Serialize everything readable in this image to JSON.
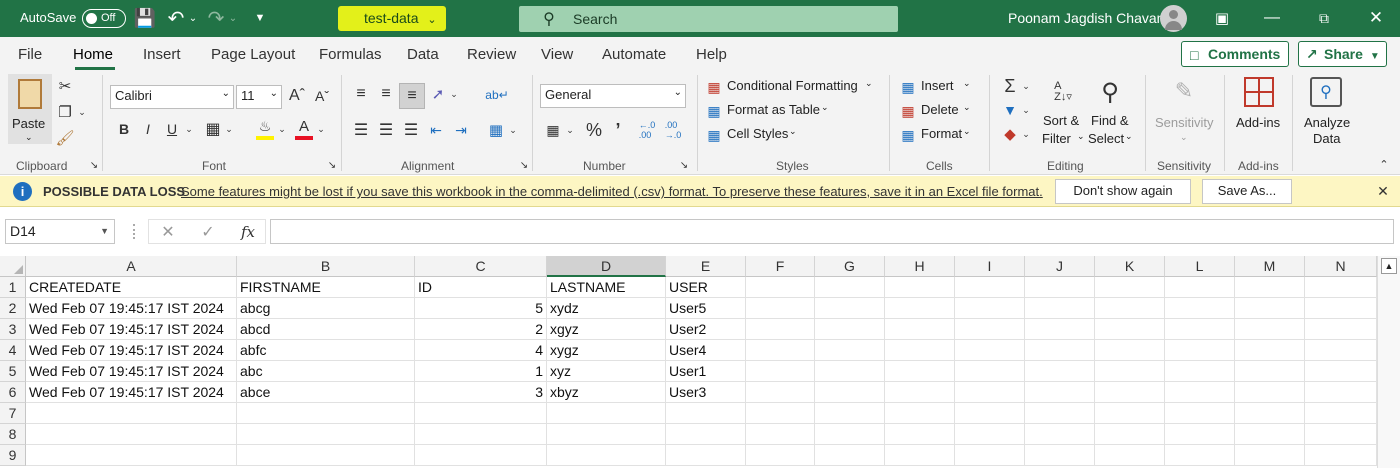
{
  "titlebar": {
    "autosave_label": "AutoSave",
    "autosave_state": "Off",
    "filename": "test-data",
    "search_placeholder": "Search",
    "user_name": "Poonam Jagdish Chavan"
  },
  "tabs": [
    "File",
    "Home",
    "Insert",
    "Page Layout",
    "Formulas",
    "Data",
    "Review",
    "View",
    "Automate",
    "Help"
  ],
  "active_tab": "Home",
  "actions": {
    "comments": "Comments",
    "share": "Share"
  },
  "ribbon": {
    "clipboard": {
      "label": "Clipboard",
      "paste": "Paste"
    },
    "font": {
      "label": "Font",
      "name": "Calibri",
      "size": "11",
      "bold": "B",
      "italic": "I",
      "underline": "U"
    },
    "alignment": {
      "label": "Alignment"
    },
    "number": {
      "label": "Number",
      "format": "General"
    },
    "styles": {
      "label": "Styles",
      "conditional": "Conditional Formatting",
      "table": "Format as Table",
      "cell_styles": "Cell Styles"
    },
    "cells": {
      "label": "Cells",
      "insert": "Insert",
      "delete": "Delete",
      "format": "Format"
    },
    "editing": {
      "label": "Editing",
      "sort": "Sort &",
      "filter": "Filter",
      "find": "Find &",
      "select": "Select"
    },
    "sensitivity": {
      "label": "Sensitivity",
      "button": "Sensitivity"
    },
    "addins": {
      "label": "Add-ins",
      "button": "Add-ins"
    },
    "analyze": {
      "line1": "Analyze",
      "line2": "Data"
    }
  },
  "infobar": {
    "title": "POSSIBLE DATA LOSS",
    "message": "Some features might be lost if you save this workbook in the comma-delimited (.csv) format. To preserve these features, save it in an Excel file format.",
    "dont_show": "Don't show again",
    "save_as": "Save As..."
  },
  "formula_bar": {
    "name_box": "D14",
    "fx": "fx",
    "formula": ""
  },
  "sheet": {
    "columns": [
      "A",
      "B",
      "C",
      "D",
      "E",
      "F",
      "G",
      "H",
      "I",
      "J",
      "K",
      "L",
      "M",
      "N"
    ],
    "rows": [
      "1",
      "2",
      "3",
      "4",
      "5",
      "6",
      "7",
      "8",
      "9"
    ],
    "cells": [
      [
        "CREATEDATE",
        "FIRSTNAME",
        "ID",
        "LASTNAME",
        "USER"
      ],
      [
        "Wed Feb 07 19:45:17 IST 2024",
        "abcg",
        "5",
        "xydz",
        "User5"
      ],
      [
        "Wed Feb 07 19:45:17 IST 2024",
        "abcd",
        "2",
        "xgyz",
        "User2"
      ],
      [
        "Wed Feb 07 19:45:17 IST 2024",
        "abfc",
        "4",
        "xygz",
        "User4"
      ],
      [
        "Wed Feb 07 19:45:17 IST 2024",
        "abc",
        "1",
        "xyz",
        "User1"
      ],
      [
        "Wed Feb 07 19:45:17 IST 2024",
        "abce",
        "3",
        "xbyz",
        "User3"
      ]
    ]
  },
  "colors": {
    "excel_green": "#217346",
    "filename_highlight": "#e3f01a",
    "info_yellow": "#fdf6c3",
    "data_loss_icon": "#1f6fbf",
    "font_color_red": "#e81123",
    "highlight_yellow": "#fff200"
  }
}
